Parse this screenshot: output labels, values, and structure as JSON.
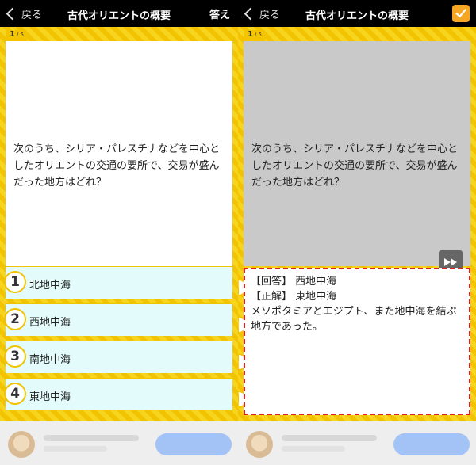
{
  "left": {
    "back_label": "戻る",
    "title": "古代オリエントの概要",
    "answer_label": "答え",
    "counter": {
      "current": "1",
      "total": "/ 5"
    },
    "question": "次のうち、シリア・パレスチナなどを中心としたオリエントの交通の要所で、交易が盛んだった地方はどれ？",
    "choices": [
      {
        "num": "1",
        "label": "北地中海"
      },
      {
        "num": "2",
        "label": "西地中海"
      },
      {
        "num": "3",
        "label": "南地中海"
      },
      {
        "num": "4",
        "label": "東地中海"
      }
    ]
  },
  "right": {
    "back_label": "戻る",
    "title": "古代オリエントの概要",
    "counter": {
      "current": "1",
      "total": "/ 5"
    },
    "question": "次のうち、シリア・パレスチナなどを中心としたオリエントの交通の要所で、交易が盛んだった地方はどれ？",
    "explanation": {
      "answer_line": "【回答】 西地中海",
      "correct_line": "【正解】 東地中海",
      "detail": "メソポタミアとエジプト、また地中海を結ぶ地方であった。"
    }
  },
  "colors": {
    "accent_yellow": "#f2c300",
    "choice_bg": "#e3fbfb",
    "dashed_red": "#e02020",
    "checkbox_orange": "#f5a623"
  },
  "icons": [
    "chevron-left-icon",
    "checkmark-icon",
    "fast-forward-icon"
  ]
}
